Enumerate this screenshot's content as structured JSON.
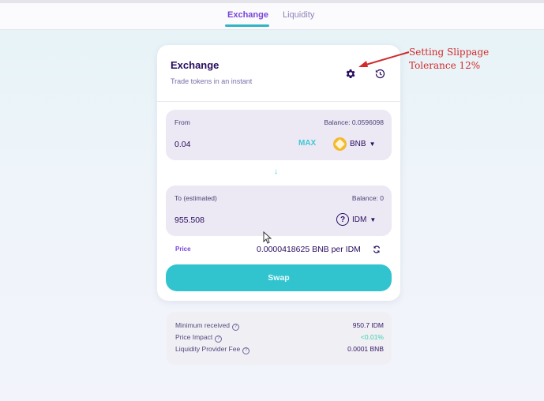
{
  "tabs": [
    {
      "label": "Exchange",
      "active": true
    },
    {
      "label": "Liquidity",
      "active": false
    }
  ],
  "card": {
    "title": "Exchange",
    "subtitle": "Trade tokens in an instant",
    "icons": {
      "settings": "gear-icon",
      "history": "history-icon"
    }
  },
  "from": {
    "label": "From",
    "balance": "Balance: 0.0596098",
    "value": "0.04",
    "max_label": "MAX",
    "token": "BNB"
  },
  "to": {
    "label": "To (estimated)",
    "balance": "Balance: 0",
    "value": "955.508",
    "token": "IDM"
  },
  "price": {
    "label": "Price",
    "value": "0.0000418625 BNB per IDM"
  },
  "swap_label": "Swap",
  "details": [
    {
      "label": "Minimum received",
      "value": "950.7 IDM"
    },
    {
      "label": "Price Impact",
      "value": "<0.01%"
    },
    {
      "label": "Liquidity Provider Fee",
      "value": "0.0001 BNB"
    }
  ],
  "annotation": {
    "line1": "Setting Slippage",
    "line2": "Tolerance 12%"
  },
  "colors": {
    "accent_purple": "#7645d9",
    "teal": "#31c4cf",
    "text_dark": "#280d5f",
    "annotation_red": "#d12a2a",
    "positive_green": "#31d0aa"
  }
}
